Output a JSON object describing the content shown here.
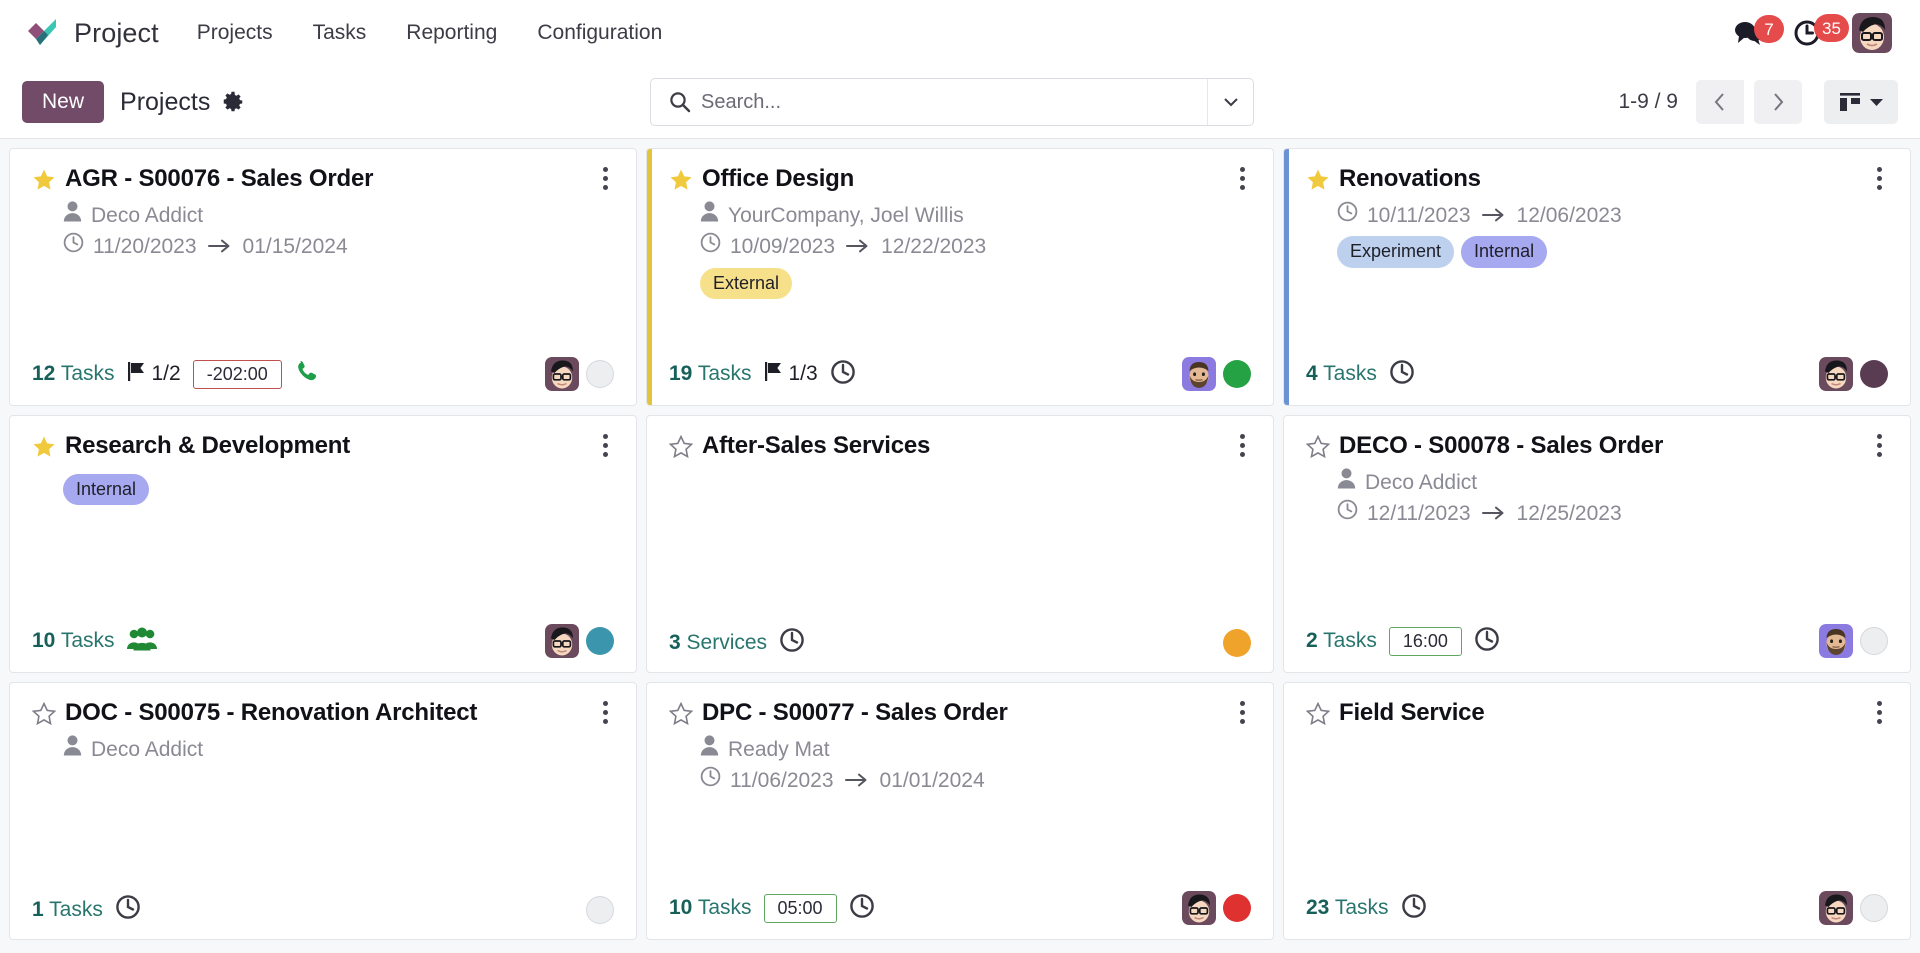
{
  "navbar": {
    "brand": "Project",
    "logo_icon": "odoo-project-checkmark-logo",
    "menu": [
      {
        "label": "Projects",
        "name": "projects"
      },
      {
        "label": "Tasks",
        "name": "tasks"
      },
      {
        "label": "Reporting",
        "name": "reporting"
      },
      {
        "label": "Configuration",
        "name": "configuration"
      }
    ],
    "systray": {
      "messages_icon": "chat-bubbles-icon",
      "messages_count": "7",
      "activities_icon": "clock-icon",
      "activities_count": "35",
      "avatar_icon": "user-avatar"
    }
  },
  "control_panel": {
    "new_label": "New",
    "breadcrumb": "Projects",
    "gear_icon": "gear-icon",
    "search": {
      "placeholder": "Search...",
      "value": "",
      "icon": "search-icon",
      "dropdown_icon": "caret-down-icon"
    },
    "pager": {
      "range": "1-9 / 9",
      "prev_icon": "chevron-left-icon",
      "next_icon": "chevron-right-icon"
    },
    "view_switcher": {
      "active": "kanban",
      "icon": "kanban-view-icon",
      "caret_icon": "caret-down-icon"
    }
  },
  "colors": {
    "brand_purple": "#714b67",
    "badge_red": "#e64b4b",
    "stripe_gold": "#e4c43a",
    "stripe_blue": "#6a93d4",
    "tag_external": "#f7e08a",
    "tag_internal": "#a6a8f0",
    "tag_experiment": "#bdd0ee",
    "task_teal": "#17605a",
    "time_neg_border": "#c0504d",
    "time_pos_border": "#62a663"
  },
  "cards": [
    {
      "id": "agr-s00076-sales-order",
      "title": "AGR - S00076 - Sales Order",
      "starred": true,
      "stripe": null,
      "partner": "Deco Addict",
      "date_start": "11/20/2023",
      "date_end": "01/15/2024",
      "tags": [],
      "count_value": "12",
      "count_label": "Tasks",
      "flag": "1/2",
      "time_badge": "-202:00",
      "time_badge_state": "neg",
      "activity_icon": "phone-icon",
      "activity_color": "#1f9e4a",
      "avatar": "dark-hair-glasses",
      "status_color": null
    },
    {
      "id": "office-design",
      "title": "Office Design",
      "starred": true,
      "stripe": "#e4c43a",
      "partner": "YourCompany, Joel Willis",
      "date_start": "10/09/2023",
      "date_end": "12/22/2023",
      "tags": [
        {
          "label": "External",
          "color": "#f7e08a"
        }
      ],
      "count_value": "19",
      "count_label": "Tasks",
      "flag": "1/3",
      "time_badge": null,
      "time_badge_state": null,
      "activity_icon": "clock-icon",
      "activity_color": "#3c3c46",
      "avatar": "bearded-purple",
      "status_color": "#25a244"
    },
    {
      "id": "renovations",
      "title": "Renovations",
      "starred": true,
      "stripe": "#6a93d4",
      "partner": null,
      "date_start": "10/11/2023",
      "date_end": "12/06/2023",
      "tags": [
        {
          "label": "Experiment",
          "color": "#bdd0ee"
        },
        {
          "label": "Internal",
          "color": "#a6a8f0"
        }
      ],
      "count_value": "4",
      "count_label": "Tasks",
      "flag": null,
      "time_badge": null,
      "time_badge_state": null,
      "activity_icon": "clock-icon",
      "activity_color": "#3c3c46",
      "avatar": "dark-hair-glasses",
      "status_color": "#5a3c52"
    },
    {
      "id": "research-and-development",
      "title": "Research & Development",
      "starred": true,
      "stripe": null,
      "partner": null,
      "date_start": null,
      "date_end": null,
      "tags": [
        {
          "label": "Internal",
          "color": "#a6a8f0"
        }
      ],
      "count_value": "10",
      "count_label": "Tasks",
      "flag": null,
      "time_badge": null,
      "time_badge_state": null,
      "activity_icon": "users-icon",
      "activity_color": "#1f8a33",
      "avatar": "dark-hair-glasses",
      "status_color": "#3b96ad"
    },
    {
      "id": "after-sales-services",
      "title": "After-Sales Services",
      "starred": false,
      "stripe": null,
      "partner": null,
      "date_start": null,
      "date_end": null,
      "tags": [],
      "count_value": "3",
      "count_label": "Services",
      "flag": null,
      "time_badge": null,
      "time_badge_state": null,
      "activity_icon": "clock-icon",
      "activity_color": "#3c3c46",
      "avatar": null,
      "status_color": "#f0a32a"
    },
    {
      "id": "deco-s00078-sales-order",
      "title": "DECO - S00078 - Sales Order",
      "starred": false,
      "stripe": null,
      "partner": "Deco Addict",
      "date_start": "12/11/2023",
      "date_end": "12/25/2023",
      "tags": [],
      "count_value": "2",
      "count_label": "Tasks",
      "flag": null,
      "time_badge": "16:00",
      "time_badge_state": "pos",
      "activity_icon": "clock-icon",
      "activity_color": "#3c3c46",
      "avatar": "bearded-purple",
      "status_color": null
    },
    {
      "id": "doc-s00075-renovation-architect",
      "title": "DOC - S00075 - Renovation Architect",
      "starred": false,
      "stripe": null,
      "partner": "Deco Addict",
      "date_start": null,
      "date_end": null,
      "tags": [],
      "count_value": "1",
      "count_label": "Tasks",
      "flag": null,
      "time_badge": null,
      "time_badge_state": null,
      "activity_icon": "clock-icon",
      "activity_color": "#3c3c46",
      "avatar": null,
      "status_color": null
    },
    {
      "id": "dpc-s00077-sales-order",
      "title": "DPC - S00077 - Sales Order",
      "starred": false,
      "stripe": null,
      "partner": "Ready Mat",
      "date_start": "11/06/2023",
      "date_end": "01/01/2024",
      "tags": [],
      "count_value": "10",
      "count_label": "Tasks",
      "flag": null,
      "time_badge": "05:00",
      "time_badge_state": "pos",
      "activity_icon": "clock-icon",
      "activity_color": "#3c3c46",
      "avatar": "dark-hair-glasses",
      "status_color": "#e03131"
    },
    {
      "id": "field-service",
      "title": "Field Service",
      "starred": false,
      "stripe": null,
      "partner": null,
      "date_start": null,
      "date_end": null,
      "tags": [],
      "count_value": "23",
      "count_label": "Tasks",
      "flag": null,
      "time_badge": null,
      "time_badge_state": null,
      "activity_icon": "clock-icon",
      "activity_color": "#3c3c46",
      "avatar": "dark-hair-glasses",
      "status_color": null
    }
  ]
}
